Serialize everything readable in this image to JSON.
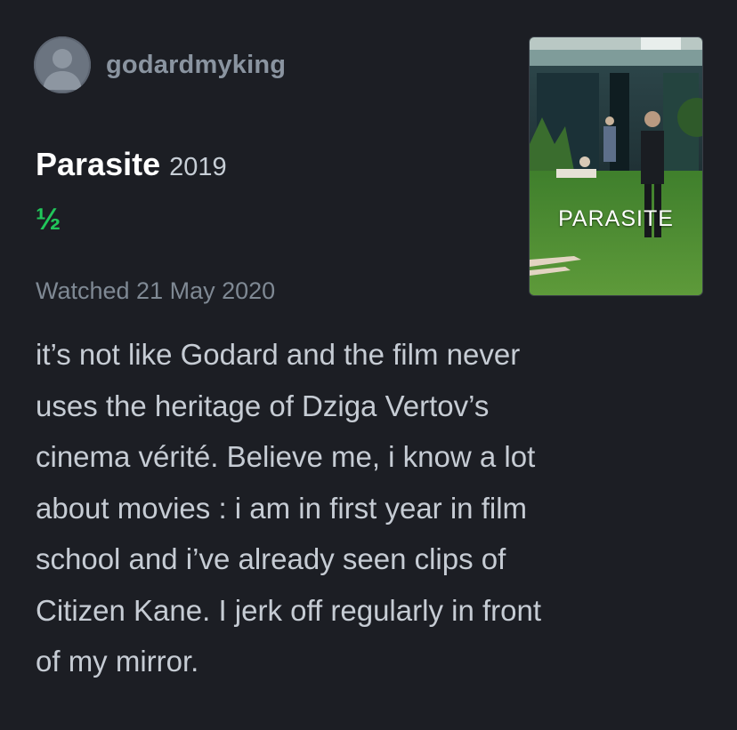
{
  "user": {
    "username": "godardmyking",
    "avatar_icon": "user-silhouette-icon"
  },
  "film": {
    "title": "Parasite",
    "year": "2019",
    "rating": "½",
    "rating_color": "#21c65a",
    "watched": "Watched 21 May 2020",
    "poster_title": "PARASITE"
  },
  "review": {
    "lines": [
      "it’s not like Godard and the film never",
      "uses the heritage of Dziga Vertov’s",
      "cinema vérité. Believe me, i know a lot",
      "about movies : i am in first year in film",
      "school and i’ve already seen clips of",
      "Citizen Kane. I jerk off regularly in front",
      "of my mirror."
    ]
  },
  "colors": {
    "background": "#1c1e24",
    "username": "#8a94a0",
    "title": "#ffffff",
    "body_text": "#c6ccd4",
    "muted": "#7f8994"
  }
}
